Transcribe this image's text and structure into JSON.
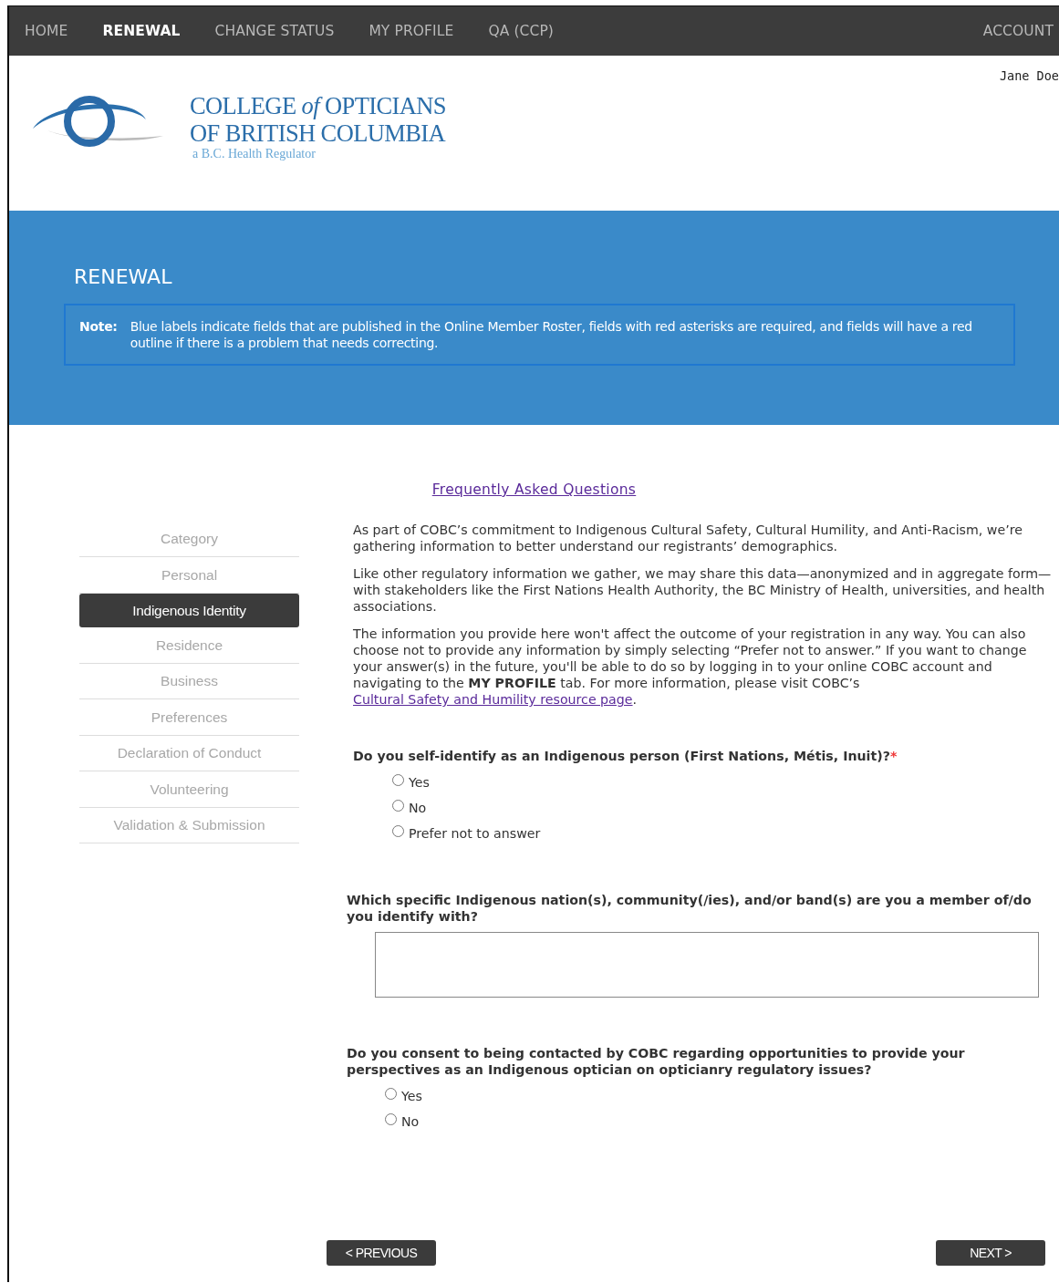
{
  "nav": [
    {
      "label": "HOME",
      "selected": false
    },
    {
      "label": "RENEWAL",
      "selected": true
    },
    {
      "label": "CHANGE STATUS",
      "selected": false
    },
    {
      "label": "MY PROFILE",
      "selected": false
    },
    {
      "label": "QA (CCP)",
      "selected": false
    }
  ],
  "account": "ACCOUNT",
  "user": "Jane Doe",
  "logo": {
    "line1": "COLLEGE *of* OPTICIANS",
    "line2": "OF BRITISH COLUMBIA",
    "tagline": "a B.C. Health Regulator"
  },
  "banner": {
    "title": "RENEWAL",
    "note_label": "Note:",
    "note": "Blue labels indicate fields that are published in the Online Member Roster, fields with red asterisks are required, and fields will have a red outline if there is a problem that needs correcting."
  },
  "faq_link": "Frequently Asked Questions",
  "steps": [
    {
      "label": "Category",
      "selected": false
    },
    {
      "label": "Personal",
      "selected": false
    },
    {
      "label": "Indigenous Identity",
      "selected": true
    },
    {
      "label": "Residence",
      "selected": false
    },
    {
      "label": "Business",
      "selected": false
    },
    {
      "label": "Preferences",
      "selected": false
    },
    {
      "label": "Declaration of Conduct",
      "selected": false
    },
    {
      "label": "Volunteering",
      "selected": false
    },
    {
      "label": "Validation & Submission",
      "selected": false
    }
  ],
  "intro": [
    {
      "text": "As part of COBC’s commitment to Indigenous Cultural Safety, Cultural Humility, and Anti-Racism, we’re gathering information to better understand our registrants’ demographics."
    },
    {
      "text": "Like other regulatory information we gather, we may share this data—anonymized and in aggregate form—with stakeholders like the First Nations Health Authority, the BC Ministry of Health, universities, and health associations."
    },
    {
      "text": "The information you provide here won't affect the outcome of your registration in any way. You can also choose not to provide any information by simply selecting “Prefer not to answer.” If you want to change your answer(s) in the future, you'll be able to do so by logging in to your online COBC account and navigating to the **MY PROFILE** tab. For more information, please visit COBC’s ",
      "link": "Cultural Safety and Humility resource page",
      "after": "."
    }
  ],
  "questions": [
    {
      "kind": "radio",
      "label": "Do you self-identify as an Indigenous person (First Nations, Métis, Inuit)?",
      "required_mark": "*",
      "options": [
        {
          "label": "Yes",
          "selected": false
        },
        {
          "label": "No",
          "selected": false
        },
        {
          "label": "Prefer not to answer",
          "selected": false
        }
      ]
    },
    {
      "kind": "text",
      "label": "Which specific Indigenous nation(s), community(/ies), and/or band(s) are you a member of/do you identify with?"
    },
    {
      "kind": "radio",
      "label": "Do you consent to being contacted by COBC regarding opportunities to provide your perspectives as an Indigenous optician on opticianry regulatory issues?",
      "options": [
        {
          "label": "Yes",
          "selected": false
        },
        {
          "label": "No",
          "selected": false
        }
      ]
    }
  ],
  "buttons": {
    "previous": "< PREVIOUS",
    "next": "NEXT >"
  }
}
